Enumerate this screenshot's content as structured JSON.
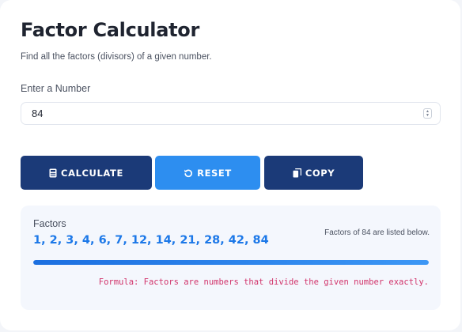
{
  "header": {
    "title": "Factor Calculator",
    "subtitle": "Find all the factors (divisors) of a given number."
  },
  "form": {
    "number_label": "Enter a Number",
    "number_value": "84"
  },
  "buttons": {
    "calculate": {
      "label": "CALCULATE",
      "icon": "calculator-icon",
      "color": "#1b3a78"
    },
    "reset": {
      "label": "RESET",
      "icon": "reset-icon",
      "color": "#2d8ef0"
    },
    "copy": {
      "label": "COPY",
      "icon": "copy-icon",
      "color": "#1b3a78"
    }
  },
  "result": {
    "label": "Factors",
    "values": "1, 2, 3, 4, 6, 7, 12, 14, 21, 28, 42, 84",
    "note": "Factors of 84 are listed below.",
    "progress": 1.0,
    "formula": "Formula: Factors are numbers that divide the given number exactly."
  },
  "colors": {
    "accent": "#1c78e8",
    "primary_dark": "#1b3a78",
    "formula": "#d1336a"
  }
}
